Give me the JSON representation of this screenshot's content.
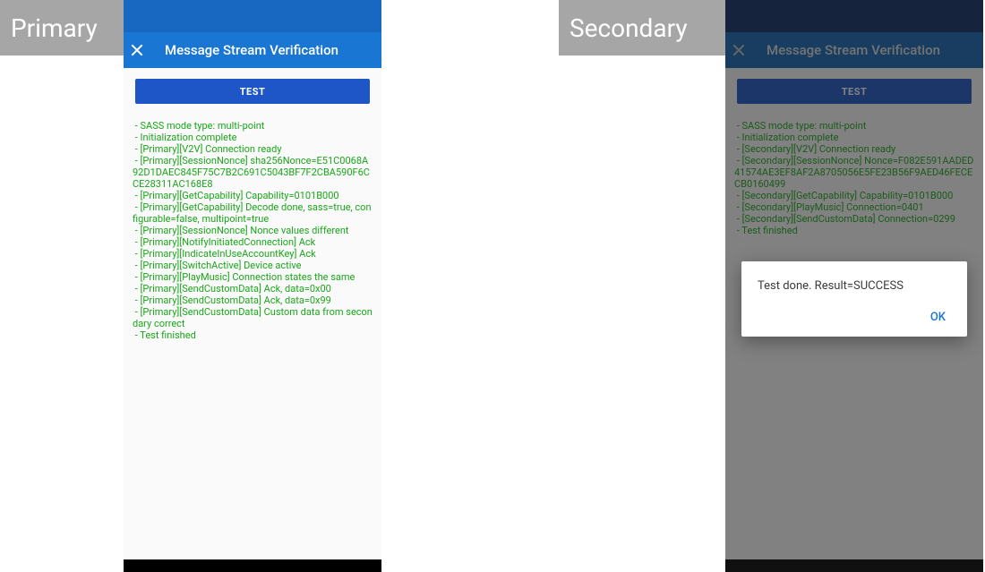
{
  "colors": {
    "label_bg": "#a6a6a6",
    "status_bar_primary": "#1867c0",
    "status_bar_secondary": "#0d2d62",
    "app_bar": "#1976d2",
    "test_btn": "#1e56c8",
    "log_text": "#1aa61a",
    "dialog_ok": "#1976d2"
  },
  "labels": {
    "primary": "Primary",
    "secondary": "Secondary"
  },
  "app_bar": {
    "title": "Message Stream Verification"
  },
  "buttons": {
    "test": "TEST"
  },
  "primary_log": " - SASS mode type: multi-point\n - Initialization complete\n - [Primary][V2V] Connection ready\n - [Primary][SessionNonce] sha256Nonce=E51C0068A92D1DAEC845F75C7B2C691C5043BF7F2CBA590F6CCE28311AC168E8\n - [Primary][GetCapability] Capability=0101B000\n - [Primary][GetCapability] Decode done, sass=true, configurable=false, multipoint=true\n - [Primary][SessionNonce] Nonce values different\n - [Primary][NotifyInitiatedConnection] Ack\n - [Primary][IndicateInUseAccountKey] Ack\n - [Primary][SwitchActive] Device active\n - [Primary][PlayMusic] Connection states the same\n - [Primary][SendCustomData] Ack, data=0x00\n - [Primary][SendCustomData] Ack, data=0x99\n - [Primary][SendCustomData] Custom data from secondary correct\n - Test finished",
  "secondary_log": " - SASS mode type: multi-point\n - Initialization complete\n - [Secondary][V2V] Connection ready\n - [Secondary][SessionNonce] Nonce=F082E591AADED41574AE3EF8AF2A8705056E5FE23B56F9AED46FECECB0160499\n - [Secondary][GetCapability] Capability=0101B000\n - [Secondary][PlayMusic] Connection=0401\n - [Secondary][SendCustomData] Connection=0299\n - Test finished",
  "dialog": {
    "message": "Test done. Result=SUCCESS",
    "ok_label": "OK"
  }
}
